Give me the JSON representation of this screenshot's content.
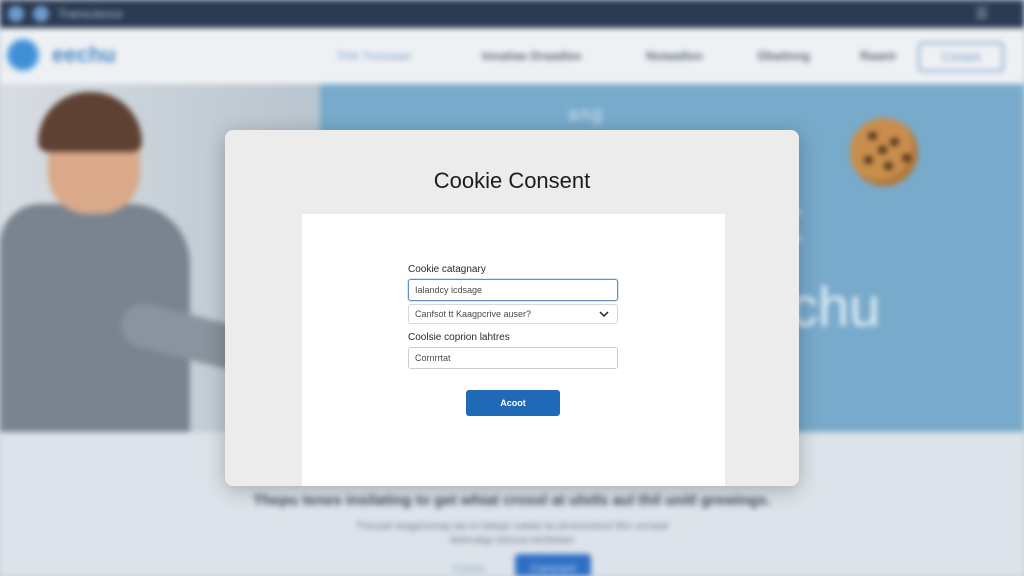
{
  "browser": {
    "title": "Transcience",
    "menu_icon": "menu-icon"
  },
  "site": {
    "logo_text": "eechu",
    "nav": [
      {
        "label": "Thtt Tnnsaan"
      },
      {
        "label": "Innatiae Draadiee"
      },
      {
        "label": "Nsiaadien"
      },
      {
        "label": "Dbaitnng"
      },
      {
        "label": "Raaeir"
      }
    ],
    "header_button": "Cnnant",
    "hero_word_top": "ang",
    "hero_word_big": "t",
    "hero_word_brand": "chu",
    "below_title": "Thepu tenes insilating to get whiat crossl at ulstls aul thil unitl grewings.",
    "below_subtitle_1": "Thanaat taagpinstrag taa ta tiatagn natata tai pinstrantand tthe onnaad",
    "below_subtitle_2": "dtahnatgs tainssa tainfataan",
    "below_button_secondary": "Caneo",
    "below_button_primary": "Cansrant"
  },
  "modal": {
    "title": "Cookie Consent",
    "category_label": "Cookie catagnary",
    "category_input_value": "Ialandcy icdsage",
    "select_value": "Canfsot tt Kaagpcrive auser?",
    "description_label": "Coolsie coprion lahtres",
    "description_input_value": "Cornrrtat",
    "accept_label": "Acoot"
  },
  "colors": {
    "accent": "#1f69b6",
    "browser_bar": "#2a3a52",
    "hero_blue": "#78aacb"
  }
}
